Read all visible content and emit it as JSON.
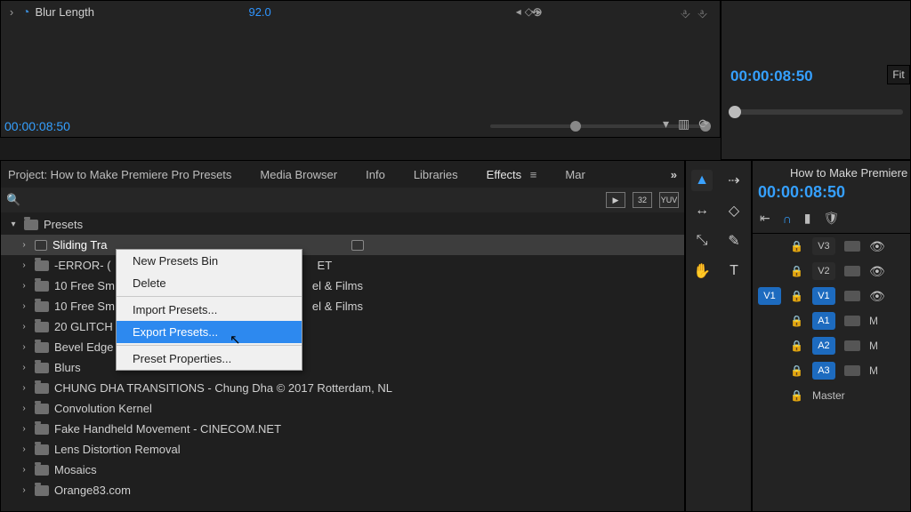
{
  "effect_controls": {
    "param_name": "Blur Length",
    "param_value": "92.0",
    "timecode": "00:00:08:50"
  },
  "program_monitor": {
    "timecode": "00:00:08:50",
    "zoom": "Fit"
  },
  "panel_tabs": {
    "project": "Project: How to Make Premiere Pro Presets",
    "media": "Media Browser",
    "info": "Info",
    "libraries": "Libraries",
    "effects": "Effects",
    "markers": "Mar"
  },
  "search": {
    "placeholder": ""
  },
  "badges": {
    "fx": "32",
    "yuv": "YUV"
  },
  "presets_root": "Presets",
  "presets": {
    "p0": "Sliding Tra",
    "p1": "-ERROR- (",
    "p1b": "ET",
    "p2": "10 Free Sm",
    "p2b": "el & Films",
    "p3": "10 Free Sm",
    "p3b": "el & Films",
    "p4": "20 GLITCH",
    "p5": "Bevel Edge",
    "p6": "Blurs",
    "p7": "CHUNG DHA TRANSITIONS - Chung Dha © 2017 Rotterdam, NL",
    "p8": "Convolution Kernel",
    "p9": "Fake Handheld Movement - CINECOM.NET",
    "p10": "Lens Distortion Removal",
    "p11": "Mosaics",
    "p12": "Orange83.com"
  },
  "context_menu": {
    "new_bin": "New Presets Bin",
    "delete": "Delete",
    "import": "Import Presets...",
    "export": "Export Presets...",
    "props": "Preset Properties..."
  },
  "timeline": {
    "title": "How to Make Premiere",
    "timecode": "00:00:08:50",
    "tracks": {
      "v3": "V3",
      "v2": "V2",
      "v1": "V1",
      "v1s": "V1",
      "a1": "A1",
      "a2": "A2",
      "a3": "A3",
      "master": "Master",
      "m": "M"
    }
  }
}
